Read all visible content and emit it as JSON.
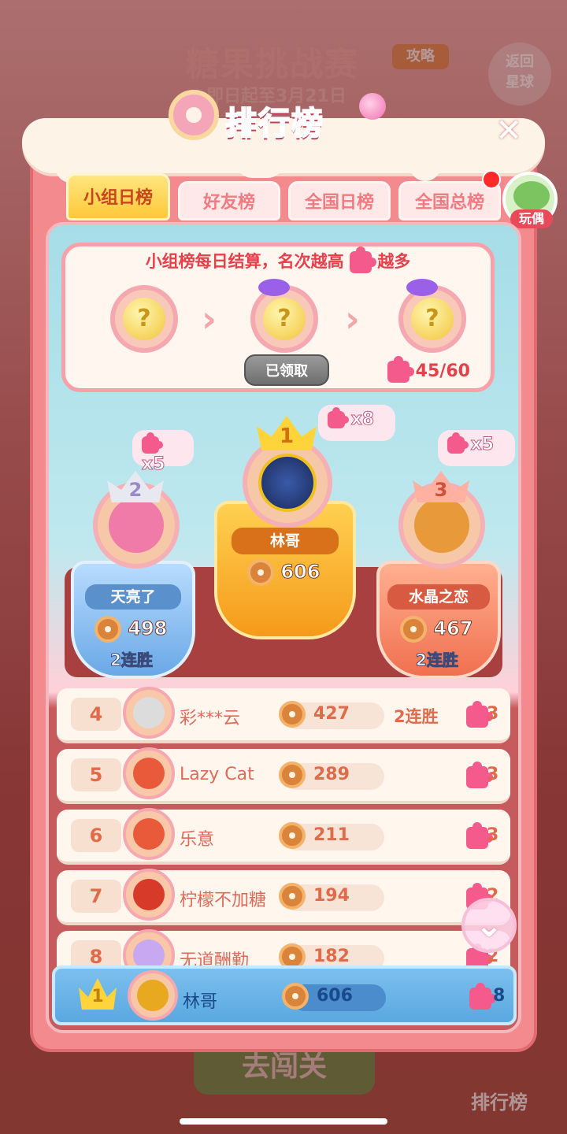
{
  "background": {
    "event_title": "糖果挑战赛",
    "event_subtitle": "即日起至3月21日",
    "guide_label": "攻略",
    "back_label_line1": "返回",
    "back_label_line2": "星球",
    "go_level_label": "去闯关",
    "leaderboard_label": "排行榜"
  },
  "panel": {
    "title": "排行榜",
    "close_icon": "close-icon"
  },
  "tabs": [
    {
      "label": "小组日榜",
      "active": true
    },
    {
      "label": "好友榜",
      "active": false
    },
    {
      "label": "全国日榜",
      "active": false
    },
    {
      "label": "全国总榜",
      "active": false
    }
  ],
  "plush": {
    "label": "玩偶"
  },
  "rewards": {
    "caption_part1": "小组榜每日结算，名次越高",
    "caption_part2": "越多",
    "claimed_label": "已领取",
    "progress": "45/60",
    "badge_symbol": "?"
  },
  "podium": [
    {
      "rank": "1",
      "name": "林哥",
      "score": "606",
      "reward": "x8",
      "streak": ""
    },
    {
      "rank": "2",
      "name": "天亮了",
      "score": "498",
      "reward": "x5",
      "streak": "2连胜"
    },
    {
      "rank": "3",
      "name": "水晶之恋",
      "score": "467",
      "reward": "x5",
      "streak": "2连胜"
    }
  ],
  "rows": [
    {
      "rank": "4",
      "name": "彩***云",
      "score": "427",
      "streak": "2连胜",
      "pieces": "3"
    },
    {
      "rank": "5",
      "name": "Lazy Cat",
      "score": "289",
      "streak": "",
      "pieces": "3"
    },
    {
      "rank": "6",
      "name": "乐意",
      "score": "211",
      "streak": "",
      "pieces": "3"
    },
    {
      "rank": "7",
      "name": "柠檬不加糖",
      "score": "194",
      "streak": "",
      "pieces": "2"
    },
    {
      "rank": "8",
      "name": "无道酬勤",
      "score": "182",
      "streak": "",
      "pieces": "2"
    }
  ],
  "self": {
    "rank": "1",
    "name": "林哥",
    "score": "606",
    "pieces": "8"
  },
  "colors": {
    "panel": "#f28a8e",
    "active_tab": "#ffc838",
    "gold_podium": "#f5a020",
    "silver_podium": "#7ab8ee",
    "bronze_podium": "#f58a6a",
    "self_row": "#5aa8e0"
  }
}
